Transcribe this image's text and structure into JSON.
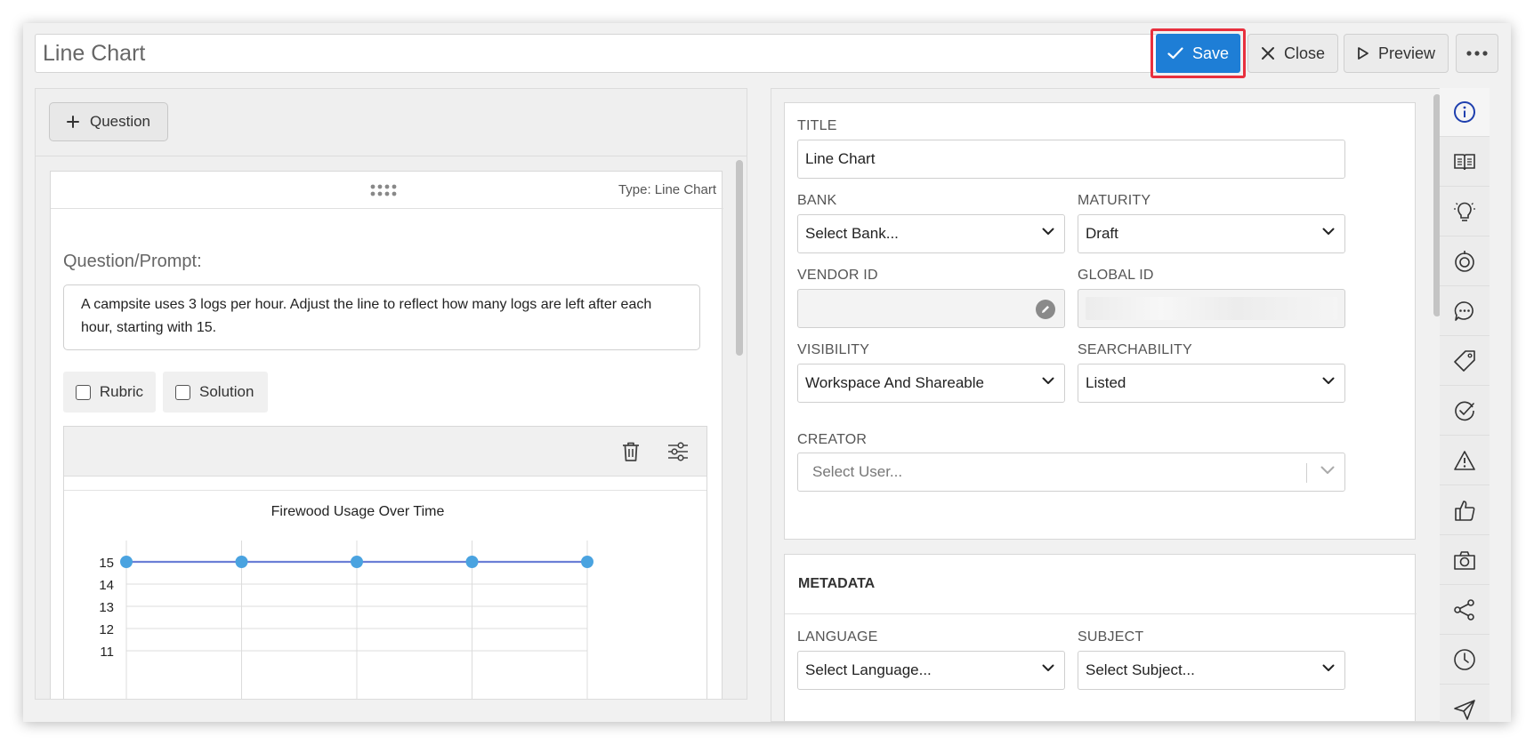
{
  "header": {
    "title_value": "Line Chart",
    "save_label": "Save",
    "close_label": "Close",
    "preview_label": "Preview"
  },
  "left": {
    "add_question_label": "Question",
    "type_label": "Type: Line Chart",
    "prompt_label": "Question/Prompt:",
    "prompt_text": "A campsite uses 3 logs per hour. Adjust the line to reflect how many logs are left after each hour, starting with 15.",
    "rubric_label": "Rubric",
    "solution_label": "Solution"
  },
  "chart_data": {
    "type": "line",
    "title": "Firewood Usage Over Time",
    "x": [
      0,
      1,
      2,
      3,
      4
    ],
    "series": [
      {
        "values": [
          15,
          15,
          15,
          15,
          15
        ]
      }
    ],
    "y_tick_labels": [
      "15",
      "14",
      "13",
      "12",
      "11"
    ],
    "ylim": [
      11,
      15
    ],
    "grid": true,
    "colors": {
      "line": "#6b7fd6",
      "point": "#4aa3e0"
    }
  },
  "details": {
    "title_label": "TITLE",
    "title_value": "Line Chart",
    "bank_label": "BANK",
    "bank_value": "Select Bank...",
    "maturity_label": "MATURITY",
    "maturity_value": "Draft",
    "vendor_id_label": "VENDOR ID",
    "vendor_id_value": "",
    "global_id_label": "GLOBAL ID",
    "visibility_label": "VISIBILITY",
    "visibility_value": "Workspace And Shareable",
    "searchability_label": "SEARCHABILITY",
    "searchability_value": "Listed",
    "creator_label": "CREATOR",
    "creator_placeholder": "Select User..."
  },
  "metadata": {
    "title": "METADATA",
    "language_label": "LANGUAGE",
    "language_value": "Select Language...",
    "subject_label": "SUBJECT",
    "subject_value": "Select Subject..."
  },
  "rail": {
    "icons": [
      "info-icon",
      "book-icon",
      "lightbulb-icon",
      "target-icon",
      "comment-icon",
      "tag-icon",
      "check-circle-icon",
      "warning-icon",
      "thumbs-up-icon",
      "camera-icon",
      "share-icon",
      "clock-icon",
      "send-icon"
    ]
  },
  "colors": {
    "accent": "#1e7ed6",
    "highlight": "#e8303e"
  }
}
